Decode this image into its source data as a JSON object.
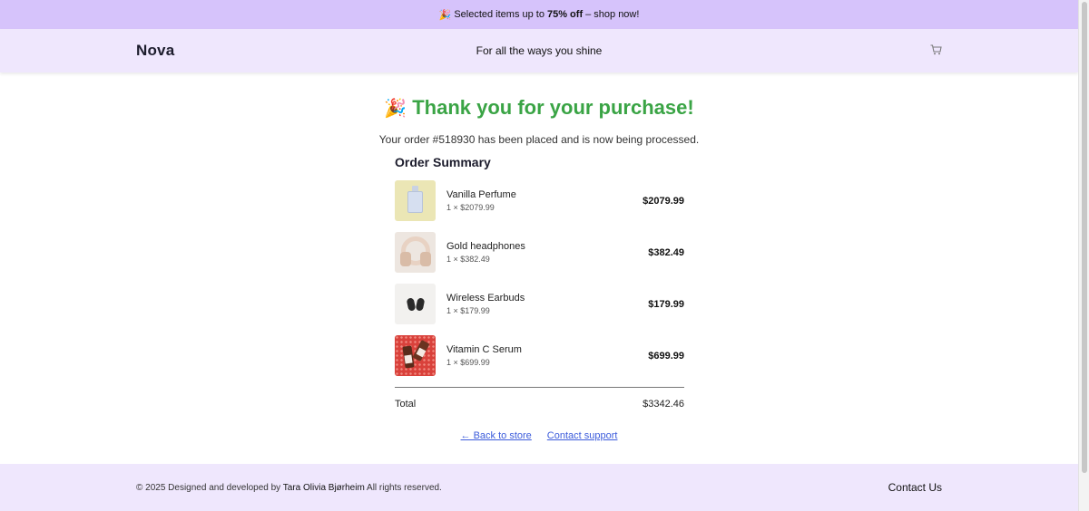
{
  "promo": {
    "emoji": "🎉",
    "text_before": "Selected items up to",
    "highlight": "75% off",
    "text_after": "– shop now!"
  },
  "header": {
    "brand": "Nova",
    "tagline": "For all the ways you shine",
    "cart_icon": "cart-icon"
  },
  "confirmation": {
    "emoji": "🎉",
    "title": "Thank you for your purchase!",
    "message": "Your order #518930 has been placed and is now being processed.",
    "title_color": "#3aa445"
  },
  "summary": {
    "title": "Order Summary",
    "items": [
      {
        "name": "Vanilla Perfume",
        "qty": "1 × $2079.99",
        "price": "$2079.99"
      },
      {
        "name": "Gold headphones",
        "qty": "1 × $382.49",
        "price": "$382.49"
      },
      {
        "name": "Wireless Earbuds",
        "qty": "1 × $179.99",
        "price": "$179.99"
      },
      {
        "name": "Vitamin C Serum",
        "qty": "1 × $699.99",
        "price": "$699.99"
      }
    ],
    "total_label": "Total",
    "total_value": "$3342.46"
  },
  "links": {
    "back": "← Back to store",
    "support": "Contact support"
  },
  "footer": {
    "copyright_before": "© 2025 Designed and developed by",
    "author": "Tara Olivia Bjørheim",
    "copyright_after": "All rights reserved.",
    "contact": "Contact Us"
  },
  "colors": {
    "promo_bg": "#d6c3fb",
    "header_bg": "#efe7fd",
    "link": "#3b5bdb"
  }
}
